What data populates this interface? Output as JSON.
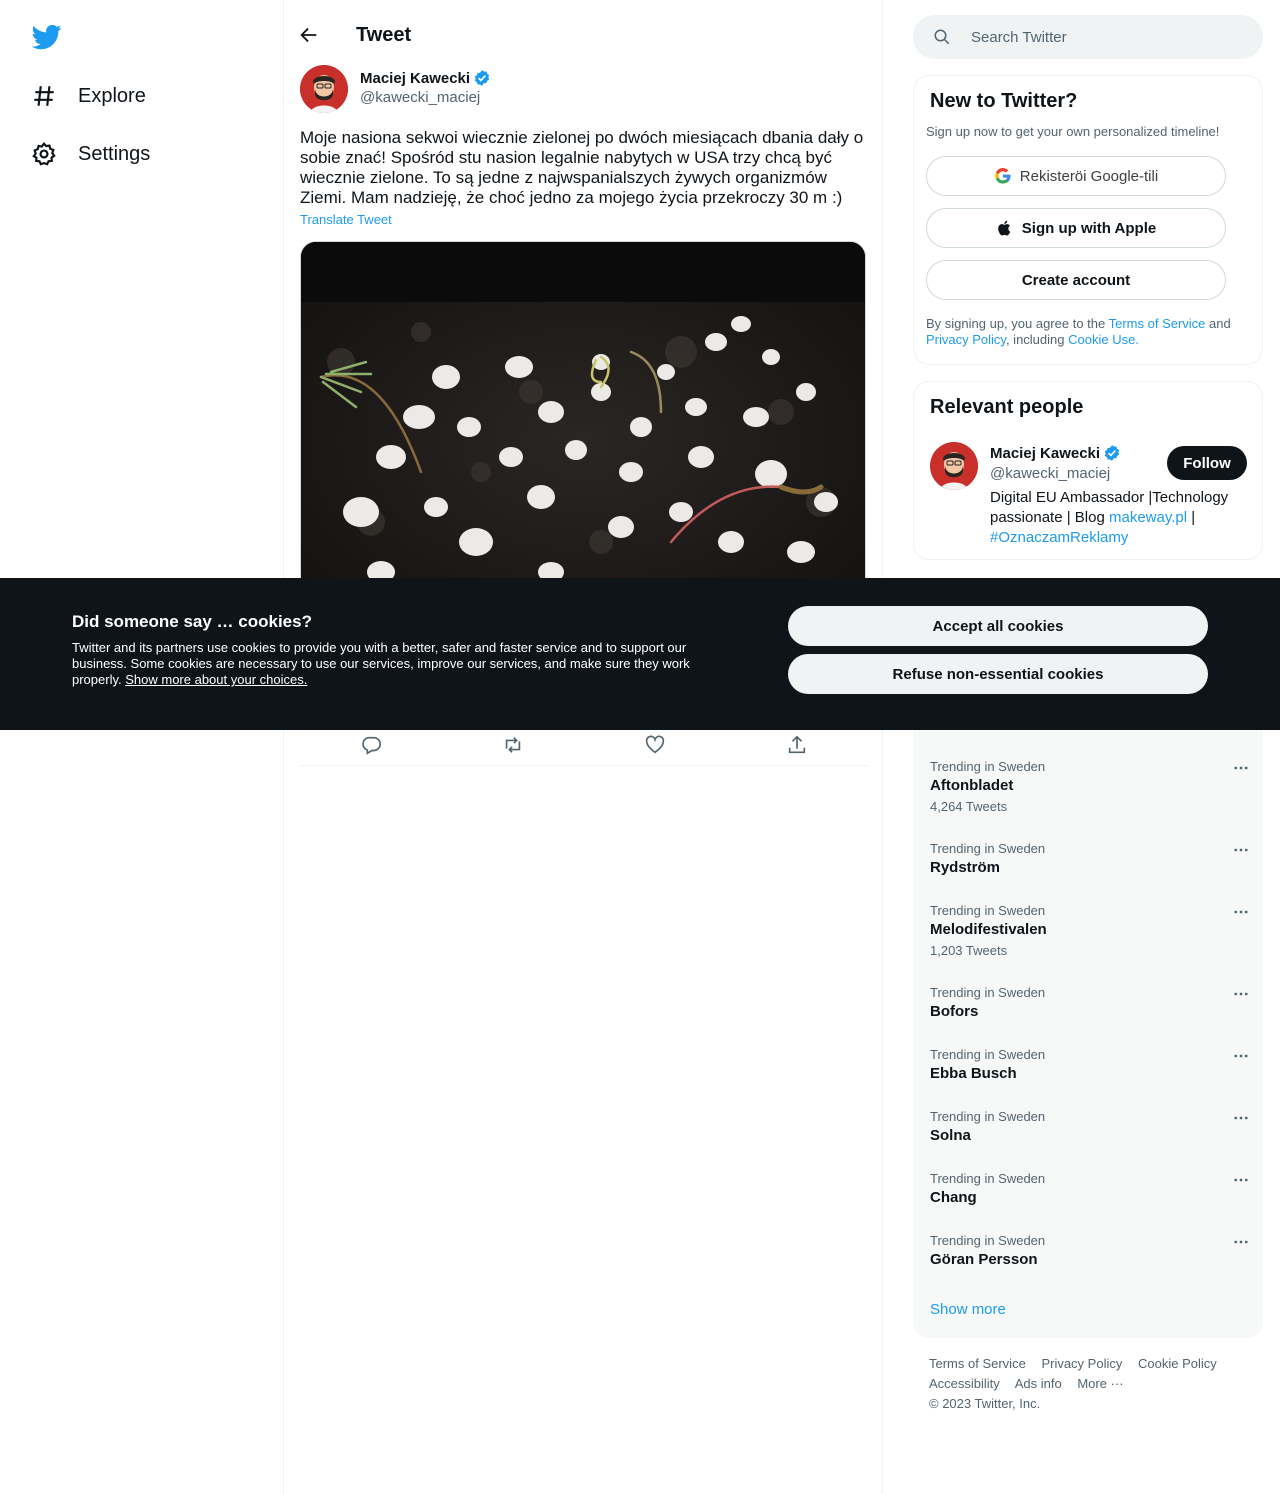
{
  "nav": {
    "logo_icon": "twitter-bird-icon",
    "items": [
      {
        "label": "Explore",
        "icon": "hashtag-icon"
      },
      {
        "label": "Settings",
        "icon": "gear-icon"
      }
    ]
  },
  "header": {
    "title": "Tweet"
  },
  "tweet": {
    "author_name": "Maciej Kawecki",
    "author_handle": "@kawecki_maciej",
    "text": "Moje nasiona sekwoi wiecznie zielonej po dwóch miesiącach dbania dały o sobie znać! Spośród stu nasion legalnie nabytych w USA trzy chcą być wiecznie zielone. To są jedne z najwspanialszych żywych organizmów Ziemi. Mam nadzieję, że choć jedno za mojego życia przekroczy 30 m :)",
    "translate_label": "Translate Tweet",
    "actions": [
      "reply-icon",
      "retweet-icon",
      "like-icon",
      "share-icon"
    ]
  },
  "search": {
    "placeholder": "Search Twitter"
  },
  "signup": {
    "title": "New to Twitter?",
    "subtitle": "Sign up now to get your own personalized timeline!",
    "google_label": "Rekisteröi Google-tili",
    "apple_label": "Sign up with Apple",
    "create_label": "Create account",
    "legal_prefix": "By signing up, you agree to the ",
    "terms_link": "Terms of Service",
    "and": " and ",
    "privacy_link": "Privacy Policy",
    "including": ", including ",
    "cookie_link": "Cookie Use."
  },
  "people": {
    "title": "Relevant people",
    "name": "Maciej Kawecki",
    "handle": "@kawecki_maciej",
    "follow_label": "Follow",
    "bio_text": "Digital EU Ambassador |Technology passionate | Blog ",
    "bio_link": "makeway.pl",
    "bio_sep": " | ",
    "bio_hashtag": "#OznaczamReklamy"
  },
  "trends": {
    "items": [
      {
        "context": "Trending in Sweden",
        "name": "Aftonbladet",
        "count": "4,264 Tweets"
      },
      {
        "context": "Trending in Sweden",
        "name": "Rydström",
        "count": ""
      },
      {
        "context": "Trending in Sweden",
        "name": "Melodifestivalen",
        "count": "1,203 Tweets"
      },
      {
        "context": "Trending in Sweden",
        "name": "Bofors",
        "count": ""
      },
      {
        "context": "Trending in Sweden",
        "name": "Ebba Busch",
        "count": ""
      },
      {
        "context": "Trending in Sweden",
        "name": "Solna",
        "count": ""
      },
      {
        "context": "Trending in Sweden",
        "name": "Chang",
        "count": ""
      },
      {
        "context": "Trending in Sweden",
        "name": "Göran Persson",
        "count": ""
      }
    ],
    "show_more": "Show more"
  },
  "footer": {
    "links": [
      "Terms of Service",
      "Privacy Policy",
      "Cookie Policy",
      "Accessibility",
      "Ads info",
      "More ···"
    ],
    "copyright": "© 2023 Twitter, Inc."
  },
  "cookie": {
    "title": "Did someone say … cookies?",
    "text": "Twitter and its partners use cookies to provide you with a better, safer and faster service and to support our business. Some cookies are necessary to use our services, improve our services, and make sure they work properly. ",
    "link": "Show more about your choices.",
    "accept_label": "Accept all cookies",
    "refuse_label": "Refuse non-essential cookies"
  },
  "colors": {
    "accent": "#1d9bf0",
    "dark": "#0f1419",
    "muted": "#536471"
  }
}
